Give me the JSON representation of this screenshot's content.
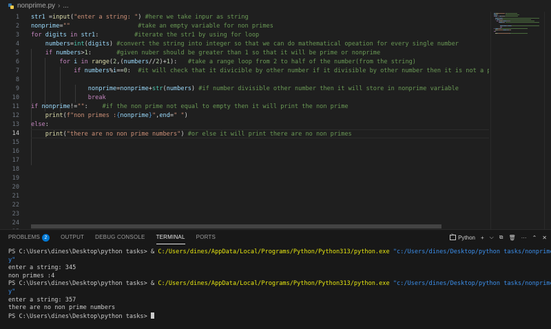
{
  "editor": {
    "breadcrumb": {
      "file": "nonprime.py",
      "more": "..."
    },
    "line_numbers": [
      "1",
      "2",
      "3",
      "4",
      "5",
      "6",
      "7",
      "8",
      "9",
      "10",
      "11",
      "12",
      "13",
      "14",
      "15",
      "16",
      "17",
      "18",
      "19",
      "20",
      "21",
      "22",
      "23",
      "24",
      "25"
    ],
    "active_line": "14",
    "code_lines": [
      [
        [
          "var",
          "str1"
        ],
        [
          "op",
          " ="
        ],
        [
          "fn",
          "input"
        ],
        [
          "op",
          "("
        ],
        [
          "str",
          "\"enter a string: \""
        ],
        [
          "op",
          ") "
        ],
        [
          "com",
          "#here we take inpur as string"
        ]
      ],
      [
        [
          "var",
          "nonprime"
        ],
        [
          "op",
          "="
        ],
        [
          "str",
          "\"\""
        ],
        [
          "op",
          "                   "
        ],
        [
          "com",
          "#take an empty variable for non primes"
        ]
      ],
      [
        [
          "kw",
          "for"
        ],
        [
          "op",
          " "
        ],
        [
          "var",
          "digits"
        ],
        [
          "op",
          " "
        ],
        [
          "kw",
          "in"
        ],
        [
          "op",
          " "
        ],
        [
          "var",
          "str1"
        ],
        [
          "op",
          ":          "
        ],
        [
          "com",
          "#iterate the str1 by using for loop"
        ]
      ],
      [
        [
          "op",
          "    "
        ],
        [
          "var",
          "numbers"
        ],
        [
          "op",
          "="
        ],
        [
          "cls",
          "int"
        ],
        [
          "op",
          "("
        ],
        [
          "var",
          "digits"
        ],
        [
          "op",
          ") "
        ],
        [
          "com",
          "#convert the string into integer so that we can do mathematical opeation for every single number"
        ]
      ],
      [
        [
          "op",
          "    "
        ],
        [
          "kw",
          "if"
        ],
        [
          "op",
          " "
        ],
        [
          "var",
          "numbers"
        ],
        [
          "op",
          ">"
        ],
        [
          "num",
          "1"
        ],
        [
          "op",
          ":       "
        ],
        [
          "com",
          "#given nuber should be greater than 1 so that it will be prime or nonprime"
        ]
      ],
      [
        [
          "op",
          "        "
        ],
        [
          "kw",
          "for"
        ],
        [
          "op",
          " "
        ],
        [
          "var",
          "i"
        ],
        [
          "op",
          " "
        ],
        [
          "kw",
          "in"
        ],
        [
          "op",
          " "
        ],
        [
          "fn",
          "range"
        ],
        [
          "op",
          "("
        ],
        [
          "num",
          "2"
        ],
        [
          "op",
          ",("
        ],
        [
          "var",
          "numbers"
        ],
        [
          "op",
          "//"
        ],
        [
          "num",
          "2"
        ],
        [
          "op",
          ")+"
        ],
        [
          "num",
          "1"
        ],
        [
          "op",
          "):   "
        ],
        [
          "com",
          "#take a range loop from 2 to half of the number(from the string)"
        ]
      ],
      [
        [
          "op",
          "            "
        ],
        [
          "kw",
          "if"
        ],
        [
          "op",
          " "
        ],
        [
          "var",
          "numbers"
        ],
        [
          "op",
          "%"
        ],
        [
          "var",
          "i"
        ],
        [
          "op",
          "=="
        ],
        [
          "num",
          "0"
        ],
        [
          "op",
          ":  "
        ],
        [
          "com",
          "#it will check that it divicible by other number if it divisible by other number then it is not a prime"
        ]
      ],
      [
        [
          "op",
          ""
        ]
      ],
      [
        [
          "op",
          "                "
        ],
        [
          "var",
          "nonprime"
        ],
        [
          "op",
          "="
        ],
        [
          "var",
          "nonprime"
        ],
        [
          "op",
          "+"
        ],
        [
          "cls",
          "str"
        ],
        [
          "op",
          "("
        ],
        [
          "var",
          "numbers"
        ],
        [
          "op",
          ") "
        ],
        [
          "com",
          "#if number divisible other number then it will store in nonprime variable"
        ]
      ],
      [
        [
          "op",
          "                "
        ],
        [
          "kw",
          "break"
        ]
      ],
      [
        [
          "kw",
          "if"
        ],
        [
          "op",
          " "
        ],
        [
          "var",
          "nonprime"
        ],
        [
          "op",
          "!="
        ],
        [
          "str",
          "\"\""
        ],
        [
          "op",
          ":    "
        ],
        [
          "com",
          "#if the non prime not equal to empty then it will print the non prime"
        ]
      ],
      [
        [
          "op",
          "    "
        ],
        [
          "fn",
          "print"
        ],
        [
          "op",
          "("
        ],
        [
          "str",
          "f\"non primes :"
        ],
        [
          "brace",
          "{"
        ],
        [
          "var",
          "nonprime"
        ],
        [
          "brace",
          "}"
        ],
        [
          "str",
          "\""
        ],
        [
          "op",
          ","
        ],
        [
          "var",
          "end"
        ],
        [
          "op",
          "="
        ],
        [
          "str",
          "\" \""
        ],
        [
          "op",
          ")"
        ]
      ],
      [
        [
          "kw",
          "else"
        ],
        [
          "op",
          ":"
        ]
      ],
      [
        [
          "op",
          "    "
        ],
        [
          "fn",
          "print"
        ],
        [
          "op",
          "("
        ],
        [
          "str",
          "\"there are no non prime numbers\""
        ],
        [
          "op",
          ") "
        ],
        [
          "com",
          "#or else it will print there are no non primes"
        ]
      ]
    ]
  },
  "panel": {
    "tabs": [
      {
        "label": "PROBLEMS",
        "badge": "2"
      },
      {
        "label": "OUTPUT"
      },
      {
        "label": "DEBUG CONSOLE"
      },
      {
        "label": "TERMINAL"
      },
      {
        "label": "PORTS"
      }
    ],
    "active_tab": "TERMINAL",
    "terminal_profile": "Python",
    "tools": {
      "add": "+",
      "split_chevron": "⌵",
      "split": "⧉",
      "trash": "🗑",
      "more": "···",
      "maximize": "⌃",
      "close": "✕"
    },
    "terminal_lines": [
      [
        [
          "plain",
          "PS C:\\Users\\dines\\Desktop\\python tasks> & "
        ],
        [
          "exe",
          "C:/Users/dines/AppData/Local/Programs/Python/Python313/python.exe"
        ],
        [
          "plain",
          " "
        ],
        [
          "arg",
          "\"c:/Users/dines/Desktop/python tasks/nonprime.p"
        ]
      ],
      [
        [
          "arg",
          "y\""
        ]
      ],
      [
        [
          "plain",
          "enter a string: 345"
        ]
      ],
      [
        [
          "plain",
          "non primes :4"
        ]
      ],
      [
        [
          "plain",
          "PS C:\\Users\\dines\\Desktop\\python tasks> & "
        ],
        [
          "exe",
          "C:/Users/dines/AppData/Local/Programs/Python/Python313/python.exe"
        ],
        [
          "plain",
          " "
        ],
        [
          "arg",
          "\"c:/Users/dines/Desktop/python tasks/nonprime.p"
        ]
      ],
      [
        [
          "arg",
          "y\""
        ]
      ],
      [
        [
          "plain",
          "enter a string: 357"
        ]
      ],
      [
        [
          "plain",
          "there are no non prime numbers"
        ]
      ],
      [
        [
          "plain",
          "PS C:\\Users\\dines\\Desktop\\python tasks> "
        ]
      ]
    ]
  },
  "colors": {
    "background": "#1f1f1f",
    "panel": "#181818",
    "accent": "#0078d4",
    "comment": "#6a9955",
    "keyword": "#c586c0",
    "string": "#ce9178",
    "variable": "#9cdcfe"
  }
}
